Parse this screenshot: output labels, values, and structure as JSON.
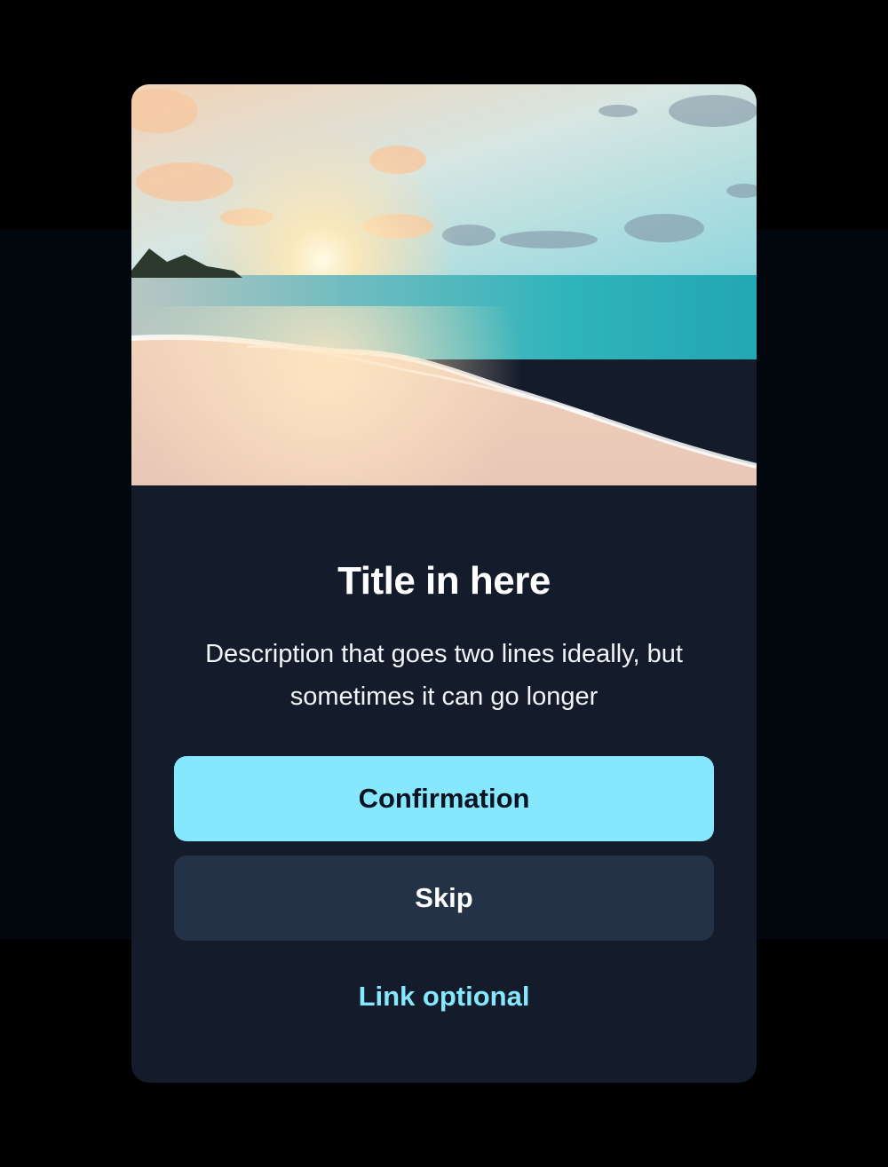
{
  "modal": {
    "image_icon": "beach-sunset-image",
    "title": "Title in here",
    "description": "Description that goes two lines ideally, but sometimes it can go longer",
    "primary_button_label": "Confirmation",
    "secondary_button_label": "Skip",
    "link_label": "Link optional"
  },
  "colors": {
    "page_background": "#000000",
    "modal_background": "#141c2b",
    "accent": "#86e8ff",
    "secondary_button": "#233247",
    "text_primary": "#ffffff"
  }
}
